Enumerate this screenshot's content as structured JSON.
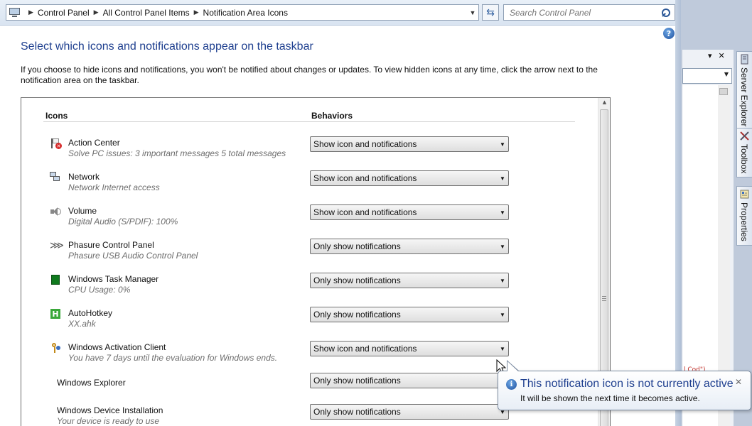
{
  "address": {
    "breadcrumbs": [
      "Control Panel",
      "All Control Panel Items",
      "Notification Area Icons"
    ],
    "search_placeholder": "Search Control Panel"
  },
  "help_label": "?",
  "page": {
    "heading": "Select which icons and notifications appear on the taskbar",
    "description": "If you choose to hide icons and notifications, you won't be notified about changes or updates. To view hidden icons at any time, click the arrow next to the notification area on the taskbar."
  },
  "table": {
    "col_icons": "Icons",
    "col_behaviors": "Behaviors",
    "rows": [
      {
        "icon": "action-center-icon",
        "name": "Action Center",
        "sub": "Solve PC issues: 3 important messages  5 total messages",
        "behavior": "Show icon and notifications"
      },
      {
        "icon": "network-icon",
        "name": "Network",
        "sub": "Network Internet access",
        "behavior": "Show icon and notifications"
      },
      {
        "icon": "volume-icon",
        "name": "Volume",
        "sub": "Digital Audio (S/PDIF): 100%",
        "behavior": "Show icon and notifications"
      },
      {
        "icon": "phasure-icon",
        "name": "Phasure Control Panel",
        "sub": "Phasure USB Audio Control Panel",
        "behavior": "Only show notifications"
      },
      {
        "icon": "task-manager-icon",
        "name": "Windows Task Manager",
        "sub": "CPU Usage: 0%",
        "behavior": "Only show notifications"
      },
      {
        "icon": "autohotkey-icon",
        "name": "AutoHotkey",
        "sub": "XX.ahk",
        "behavior": "Only show notifications"
      },
      {
        "icon": "activation-client-icon",
        "name": "Windows Activation Client",
        "sub": "You have 7 days until the evaluation for Windows ends.",
        "behavior": "Show icon and notifications"
      },
      {
        "icon": "",
        "name": "Windows Explorer",
        "sub": "",
        "behavior": "Only show notifications"
      },
      {
        "icon": "",
        "name": "Windows Device Installation",
        "sub": "Your device is ready to use",
        "behavior": "Only show notifications"
      }
    ]
  },
  "tooltip": {
    "title": "This notification icon is not currently active",
    "text": "It will be shown the next time it becomes active.",
    "close": "✕"
  },
  "ide": {
    "tabs": [
      "Server Explorer",
      "Toolbox",
      "Properties"
    ],
    "fragment": "l Cod\")"
  }
}
